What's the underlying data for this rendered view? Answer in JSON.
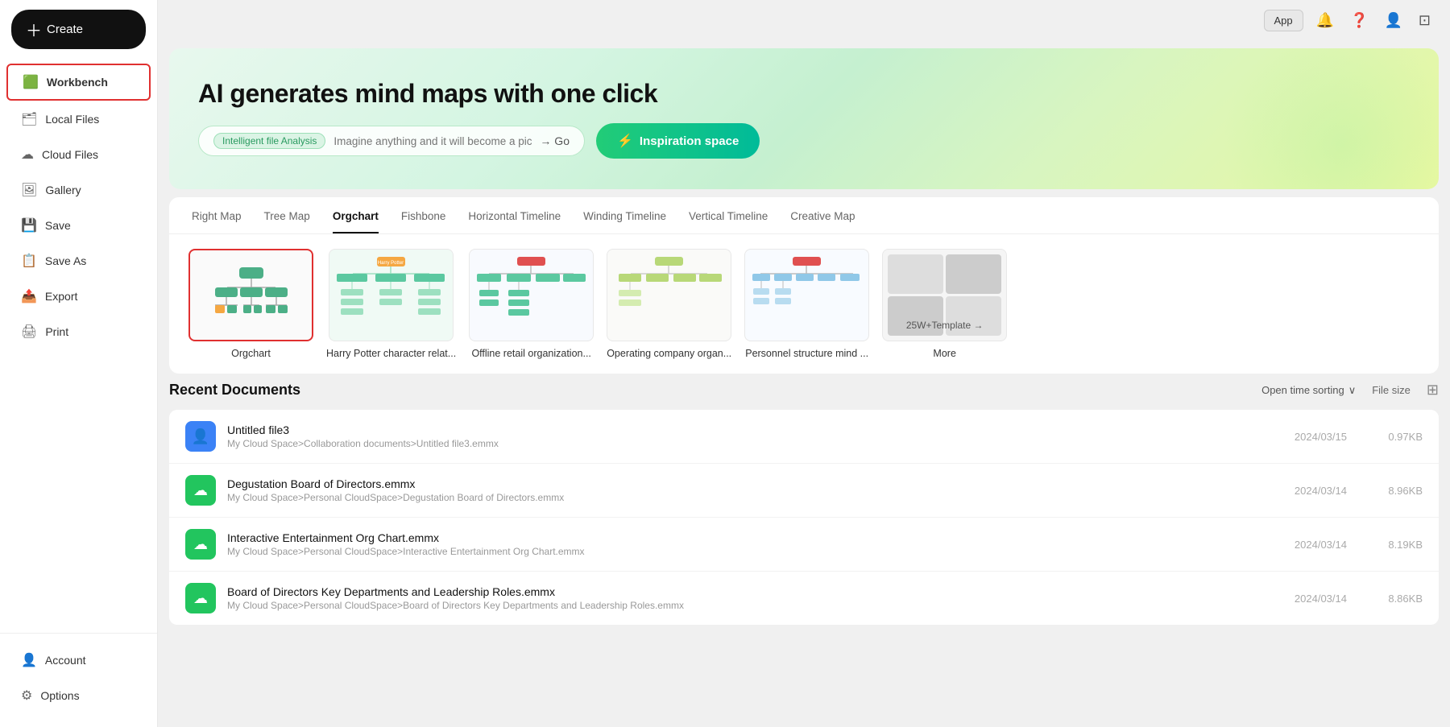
{
  "topbar": {
    "app_label": "App",
    "notification_icon": "🔔",
    "help_icon": "?",
    "profile_icon": "👤",
    "window_icon": "⊡"
  },
  "sidebar": {
    "create_label": "Create",
    "items": [
      {
        "id": "workbench",
        "label": "Workbench",
        "icon": "🟩",
        "active": true
      },
      {
        "id": "local-files",
        "label": "Local Files",
        "icon": "🗂"
      },
      {
        "id": "cloud-files",
        "label": "Cloud Files",
        "icon": "☁"
      },
      {
        "id": "gallery",
        "label": "Gallery",
        "icon": "🖼"
      },
      {
        "id": "save",
        "label": "Save",
        "icon": "💾"
      },
      {
        "id": "save-as",
        "label": "Save As",
        "icon": "📋"
      },
      {
        "id": "export",
        "label": "Export",
        "icon": "📤"
      },
      {
        "id": "print",
        "label": "Print",
        "icon": "🖨"
      }
    ],
    "bottom_items": [
      {
        "id": "account",
        "label": "Account",
        "icon": "👤"
      },
      {
        "id": "options",
        "label": "Options",
        "icon": "⚙"
      }
    ]
  },
  "hero": {
    "title": "AI generates mind maps with one click",
    "search_tag": "Intelligent file Analysis",
    "search_placeholder": "Imagine anything and it will become a picture",
    "go_label": "→ Go",
    "inspiration_label": "Inspiration space",
    "inspiration_bolt": "⚡"
  },
  "templates": {
    "tabs": [
      {
        "id": "right-map",
        "label": "Right Map",
        "active": false
      },
      {
        "id": "tree-map",
        "label": "Tree Map",
        "active": false
      },
      {
        "id": "orgchart",
        "label": "Orgchart",
        "active": true
      },
      {
        "id": "fishbone",
        "label": "Fishbone",
        "active": false
      },
      {
        "id": "horizontal-timeline",
        "label": "Horizontal Timeline",
        "active": false
      },
      {
        "id": "winding-timeline",
        "label": "Winding Timeline",
        "active": false
      },
      {
        "id": "vertical-timeline",
        "label": "Vertical Timeline",
        "active": false
      },
      {
        "id": "creative-map",
        "label": "Creative Map",
        "active": false
      }
    ],
    "cards": [
      {
        "id": "orgchart-blank",
        "label": "Orgchart",
        "type": "orgchart-blank",
        "selected": true
      },
      {
        "id": "harry-potter",
        "label": "Harry Potter character relat...",
        "type": "harry-potter",
        "selected": false
      },
      {
        "id": "offline-retail",
        "label": "Offline retail organization...",
        "type": "offline-retail",
        "selected": false
      },
      {
        "id": "operating-company",
        "label": "Operating company organ...",
        "type": "operating-company",
        "selected": false
      },
      {
        "id": "personnel-structure",
        "label": "Personnel structure mind ...",
        "type": "personnel-structure",
        "selected": false
      },
      {
        "id": "more",
        "label": "More",
        "type": "more",
        "selected": false,
        "badge": "25W+Template →"
      }
    ]
  },
  "recent": {
    "section_title": "Recent Documents",
    "sort_label": "Open time sorting",
    "sort_arrow": "∨",
    "file_size_label": "File size",
    "documents": [
      {
        "id": "doc1",
        "name": "Untitled file3",
        "path": "My Cloud Space>Collaboration documents>Untitled file3.emmx",
        "date": "2024/03/15",
        "size": "0.97KB",
        "icon_color": "blue",
        "icon": "👤"
      },
      {
        "id": "doc2",
        "name": "Degustation Board of Directors.emmx",
        "path": "My Cloud Space>Personal CloudSpace>Degustation Board of Directors.emmx",
        "date": "2024/03/14",
        "size": "8.96KB",
        "icon_color": "green",
        "icon": "☁"
      },
      {
        "id": "doc3",
        "name": "Interactive Entertainment Org Chart.emmx",
        "path": "My Cloud Space>Personal CloudSpace>Interactive Entertainment Org Chart.emmx",
        "date": "2024/03/14",
        "size": "8.19KB",
        "icon_color": "green",
        "icon": "☁"
      },
      {
        "id": "doc4",
        "name": "Board of Directors Key Departments and Leadership Roles.emmx",
        "path": "My Cloud Space>Personal CloudSpace>Board of Directors Key Departments and Leadership Roles.emmx",
        "date": "2024/03/14",
        "size": "8.86KB",
        "icon_color": "green",
        "icon": "☁"
      }
    ]
  }
}
